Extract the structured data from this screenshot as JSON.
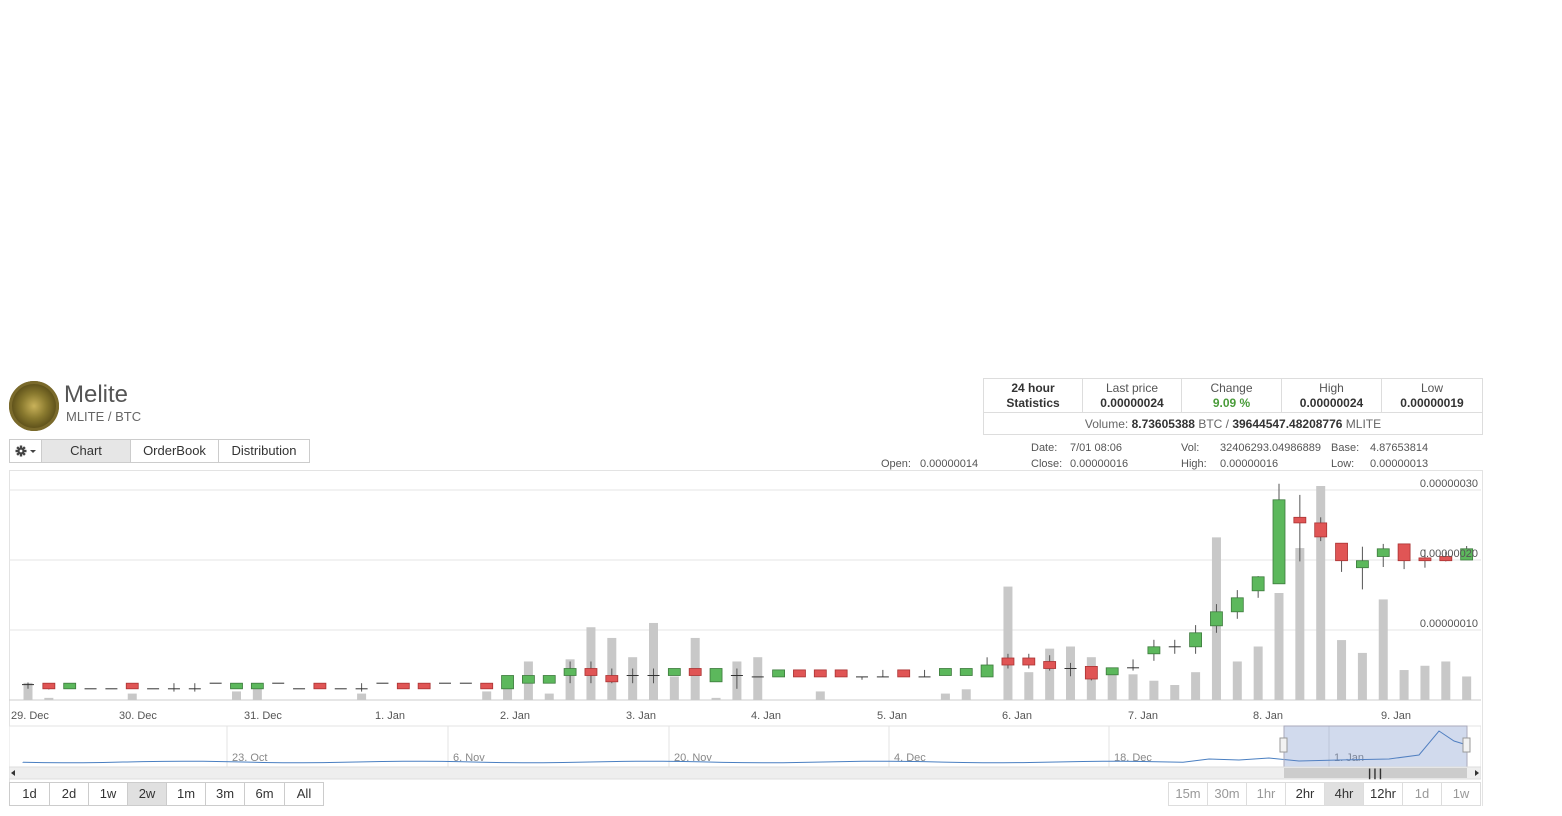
{
  "header": {
    "coin_name": "Melite",
    "pair": "MLITE / BTC"
  },
  "stats": {
    "title_line1": "24 hour",
    "title_line2": "Statistics",
    "last_price_label": "Last price",
    "last_price": "0.00000024",
    "change_label": "Change",
    "change": "9.09 %",
    "high_label": "High",
    "high": "0.00000024",
    "low_label": "Low",
    "low": "0.00000019",
    "volume_label": "Volume:",
    "volume_btc": "8.73605388",
    "volume_btc_unit": "BTC /",
    "volume_coin": "39644547.48208776",
    "volume_coin_unit": "MLITE"
  },
  "tabs": {
    "settings_icon": "gear-icon",
    "items": [
      "Chart",
      "OrderBook",
      "Distribution"
    ],
    "active": "Chart"
  },
  "readout": {
    "open_label": "Open:",
    "open": "0.00000014",
    "date_label": "Date:",
    "date": "7/01 08:06",
    "close_label": "Close:",
    "close": "0.00000016",
    "vol_label": "Vol:",
    "vol": "32406293.04986889",
    "high_label": "High:",
    "high": "0.00000016",
    "base_label": "Base:",
    "base": "4.87653814",
    "low_label": "Low:",
    "low": "0.00000013"
  },
  "chart_data": {
    "type": "candlestick",
    "y_tick_labels": [
      "0.00000010",
      "0.00000020",
      "0.00000030"
    ],
    "x_tick_labels": [
      "29. Dec",
      "30. Dec",
      "31. Dec",
      "1. Jan",
      "2. Jan",
      "3. Jan",
      "4. Jan",
      "5. Jan",
      "6. Jan",
      "7. Jan",
      "8. Jan",
      "9. Jan"
    ],
    "colors": {
      "up": "#5cb85c",
      "down": "#e05555",
      "volume": "#c8c8c8",
      "navigator": "#4a7fc1"
    },
    "candles": [
      {
        "o": 2.2e-08,
        "h": 2.5e-08,
        "l": 1.6e-08,
        "c": 2.2e-08
      },
      {
        "o": 2.4e-08,
        "h": 2.4e-08,
        "l": 1.5e-08,
        "c": 1.6e-08
      },
      {
        "o": 1.6e-08,
        "h": 2.4e-08,
        "l": 1.6e-08,
        "c": 2.4e-08
      },
      {
        "o": 1.6e-08,
        "h": 1.6e-08,
        "l": 1.6e-08,
        "c": 1.6e-08
      },
      {
        "o": 1.6e-08,
        "h": 1.6e-08,
        "l": 1.6e-08,
        "c": 1.6e-08
      },
      {
        "o": 2.4e-08,
        "h": 2.4e-08,
        "l": 1.6e-08,
        "c": 1.6e-08
      },
      {
        "o": 1.6e-08,
        "h": 1.6e-08,
        "l": 1.6e-08,
        "c": 1.6e-08
      },
      {
        "o": 1.6e-08,
        "h": 2.4e-08,
        "l": 1.2e-08,
        "c": 1.6e-08
      },
      {
        "o": 1.6e-08,
        "h": 2.4e-08,
        "l": 1.2e-08,
        "c": 1.6e-08
      },
      {
        "o": 2.4e-08,
        "h": 2.4e-08,
        "l": 2.4e-08,
        "c": 2.4e-08
      },
      {
        "o": 1.6e-08,
        "h": 2.4e-08,
        "l": 1.6e-08,
        "c": 2.4e-08
      },
      {
        "o": 1.6e-08,
        "h": 2.4e-08,
        "l": 1.6e-08,
        "c": 2.4e-08
      },
      {
        "o": 2.4e-08,
        "h": 2.4e-08,
        "l": 2.4e-08,
        "c": 2.4e-08
      },
      {
        "o": 1.6e-08,
        "h": 1.6e-08,
        "l": 1.6e-08,
        "c": 1.6e-08
      },
      {
        "o": 2.4e-08,
        "h": 2.4e-08,
        "l": 1.6e-08,
        "c": 1.6e-08
      },
      {
        "o": 1.6e-08,
        "h": 1.6e-08,
        "l": 1.6e-08,
        "c": 1.6e-08
      },
      {
        "o": 1.6e-08,
        "h": 2.4e-08,
        "l": 1.2e-08,
        "c": 1.6e-08
      },
      {
        "o": 2.4e-08,
        "h": 2.4e-08,
        "l": 2.4e-08,
        "c": 2.4e-08
      },
      {
        "o": 2.4e-08,
        "h": 2.4e-08,
        "l": 1.6e-08,
        "c": 1.6e-08
      },
      {
        "o": 2.4e-08,
        "h": 2.4e-08,
        "l": 1.6e-08,
        "c": 1.6e-08
      },
      {
        "o": 2.4e-08,
        "h": 2.4e-08,
        "l": 2.4e-08,
        "c": 2.4e-08
      },
      {
        "o": 2.4e-08,
        "h": 2.4e-08,
        "l": 2.4e-08,
        "c": 2.4e-08
      },
      {
        "o": 2.4e-08,
        "h": 2.4e-08,
        "l": 1.6e-08,
        "c": 1.6e-08
      },
      {
        "o": 1.6e-08,
        "h": 3.5e-08,
        "l": 1.6e-08,
        "c": 3.5e-08
      },
      {
        "o": 2.4e-08,
        "h": 3.5e-08,
        "l": 2.4e-08,
        "c": 3.5e-08
      },
      {
        "o": 2.4e-08,
        "h": 3.5e-08,
        "l": 2.4e-08,
        "c": 3.5e-08
      },
      {
        "o": 3.5e-08,
        "h": 5.5e-08,
        "l": 2.4e-08,
        "c": 4.5e-08
      },
      {
        "o": 4.5e-08,
        "h": 5.5e-08,
        "l": 2.4e-08,
        "c": 3.5e-08
      },
      {
        "o": 3.5e-08,
        "h": 4.5e-08,
        "l": 2.4e-08,
        "c": 2.6e-08
      },
      {
        "o": 3.5e-08,
        "h": 4.5e-08,
        "l": 2.4e-08,
        "c": 3.5e-08
      },
      {
        "o": 3.5e-08,
        "h": 4.5e-08,
        "l": 2.4e-08,
        "c": 3.5e-08
      },
      {
        "o": 3.5e-08,
        "h": 4.5e-08,
        "l": 3.5e-08,
        "c": 4.5e-08
      },
      {
        "o": 4.5e-08,
        "h": 4.5e-08,
        "l": 3.5e-08,
        "c": 3.5e-08
      },
      {
        "o": 2.6e-08,
        "h": 4.5e-08,
        "l": 2.6e-08,
        "c": 4.5e-08
      },
      {
        "o": 3.5e-08,
        "h": 4.5e-08,
        "l": 1.6e-08,
        "c": 3.5e-08
      },
      {
        "o": 3.3e-08,
        "h": 3.3e-08,
        "l": 3.3e-08,
        "c": 3.3e-08
      },
      {
        "o": 3.3e-08,
        "h": 4.3e-08,
        "l": 3.3e-08,
        "c": 4.3e-08
      },
      {
        "o": 4.3e-08,
        "h": 4.3e-08,
        "l": 3.3e-08,
        "c": 3.3e-08
      },
      {
        "o": 4.3e-08,
        "h": 4.3e-08,
        "l": 3.3e-08,
        "c": 3.3e-08
      },
      {
        "o": 4.3e-08,
        "h": 4.3e-08,
        "l": 3.3e-08,
        "c": 3.3e-08
      },
      {
        "o": 3.3e-08,
        "h": 3.3e-08,
        "l": 2.9e-08,
        "c": 3.3e-08
      },
      {
        "o": 3.3e-08,
        "h": 4.3e-08,
        "l": 3.3e-08,
        "c": 3.3e-08
      },
      {
        "o": 4.3e-08,
        "h": 4.3e-08,
        "l": 3.3e-08,
        "c": 3.3e-08
      },
      {
        "o": 3.3e-08,
        "h": 4.3e-08,
        "l": 3.3e-08,
        "c": 3.3e-08
      },
      {
        "o": 3.5e-08,
        "h": 4.5e-08,
        "l": 3.5e-08,
        "c": 4.5e-08
      },
      {
        "o": 3.5e-08,
        "h": 4.5e-08,
        "l": 3.5e-08,
        "c": 4.5e-08
      },
      {
        "o": 3.3e-08,
        "h": 6.1e-08,
        "l": 3.3e-08,
        "c": 5e-08
      },
      {
        "o": 6e-08,
        "h": 6.6e-08,
        "l": 4.5e-08,
        "c": 5e-08
      },
      {
        "o": 6e-08,
        "h": 6.6e-08,
        "l": 4.5e-08,
        "c": 5e-08
      },
      {
        "o": 5.5e-08,
        "h": 6.4e-08,
        "l": 4.2e-08,
        "c": 4.5e-08
      },
      {
        "o": 4.5e-08,
        "h": 5.3e-08,
        "l": 3.4e-08,
        "c": 4.5e-08
      },
      {
        "o": 4.8e-08,
        "h": 4.8e-08,
        "l": 2.8e-08,
        "c": 3e-08
      },
      {
        "o": 3.6e-08,
        "h": 4.6e-08,
        "l": 3.6e-08,
        "c": 4.6e-08
      },
      {
        "o": 4.6e-08,
        "h": 5.8e-08,
        "l": 4.2e-08,
        "c": 4.6e-08
      },
      {
        "o": 6.6e-08,
        "h": 8.6e-08,
        "l": 5.6e-08,
        "c": 7.6e-08
      },
      {
        "o": 7.6e-08,
        "h": 8.6e-08,
        "l": 6.6e-08,
        "c": 7.6e-08
      },
      {
        "o": 7.6e-08,
        "h": 1.07e-07,
        "l": 6.6e-08,
        "c": 9.6e-08
      },
      {
        "o": 1.06e-07,
        "h": 1.37e-07,
        "l": 9.6e-08,
        "c": 1.26e-07
      },
      {
        "o": 1.26e-07,
        "h": 1.57e-07,
        "l": 1.16e-07,
        "c": 1.46e-07
      },
      {
        "o": 1.56e-07,
        "h": 1.77e-07,
        "l": 1.46e-07,
        "c": 1.76e-07
      },
      {
        "o": 1.66e-07,
        "h": 3.09e-07,
        "l": 1.66e-07,
        "c": 2.86e-07
      },
      {
        "o": 2.61e-07,
        "h": 2.93e-07,
        "l": 1.98e-07,
        "c": 2.53e-07
      },
      {
        "o": 2.53e-07,
        "h": 2.61e-07,
        "l": 2.27e-07,
        "c": 2.33e-07
      },
      {
        "o": 2.24e-07,
        "h": 2.24e-07,
        "l": 1.83e-07,
        "c": 1.99e-07
      },
      {
        "o": 1.89e-07,
        "h": 2.19e-07,
        "l": 1.58e-07,
        "c": 1.99e-07
      },
      {
        "o": 2.05e-07,
        "h": 2.23e-07,
        "l": 1.9e-07,
        "c": 2.16e-07
      },
      {
        "o": 2.23e-07,
        "h": 2.23e-07,
        "l": 1.87e-07,
        "c": 1.99e-07
      },
      {
        "o": 2.03e-07,
        "h": 2.15e-07,
        "l": 1.89e-07,
        "c": 1.99e-07
      },
      {
        "o": 2.05e-07,
        "h": 2.12e-07,
        "l": 1.98e-07,
        "c": 1.99e-07
      },
      {
        "o": 2e-07,
        "h": 2.2e-07,
        "l": 2e-07,
        "c": 2.16e-07
      }
    ],
    "volume_relative": [
      0.08,
      0.01,
      0.0,
      0.0,
      0.0,
      0.03,
      0.0,
      0.0,
      0.0,
      0.0,
      0.04,
      0.06,
      0.0,
      0.0,
      0.0,
      0.0,
      0.03,
      0.0,
      0.0,
      0.0,
      0.0,
      0.0,
      0.04,
      0.06,
      0.18,
      0.03,
      0.19,
      0.34,
      0.29,
      0.2,
      0.36,
      0.11,
      0.29,
      0.01,
      0.18,
      0.2,
      0.0,
      0.0,
      0.04,
      0.0,
      0.0,
      0.0,
      0.0,
      0.0,
      0.03,
      0.05,
      0.0,
      0.53,
      0.13,
      0.24,
      0.25,
      0.2,
      0.12,
      0.12,
      0.09,
      0.07,
      0.13,
      0.76,
      0.18,
      0.25,
      0.5,
      0.71,
      1.0,
      0.28,
      0.22,
      0.47,
      0.14,
      0.16,
      0.18,
      0.11,
      0.08,
      0.18
    ],
    "navigator_labels": [
      "23. Oct",
      "6. Nov",
      "20. Nov",
      "4. Dec",
      "18. Dec",
      "1. Jan"
    ]
  },
  "range_buttons": {
    "items": [
      "1d",
      "2d",
      "1w",
      "2w",
      "1m",
      "3m",
      "6m",
      "All"
    ],
    "active": "2w"
  },
  "interval_buttons": {
    "items": [
      "15m",
      "30m",
      "1hr",
      "2hr",
      "4hr",
      "12hr",
      "1d",
      "1w"
    ],
    "enabled": [
      "2hr",
      "4hr",
      "12hr"
    ],
    "active": "4hr"
  }
}
